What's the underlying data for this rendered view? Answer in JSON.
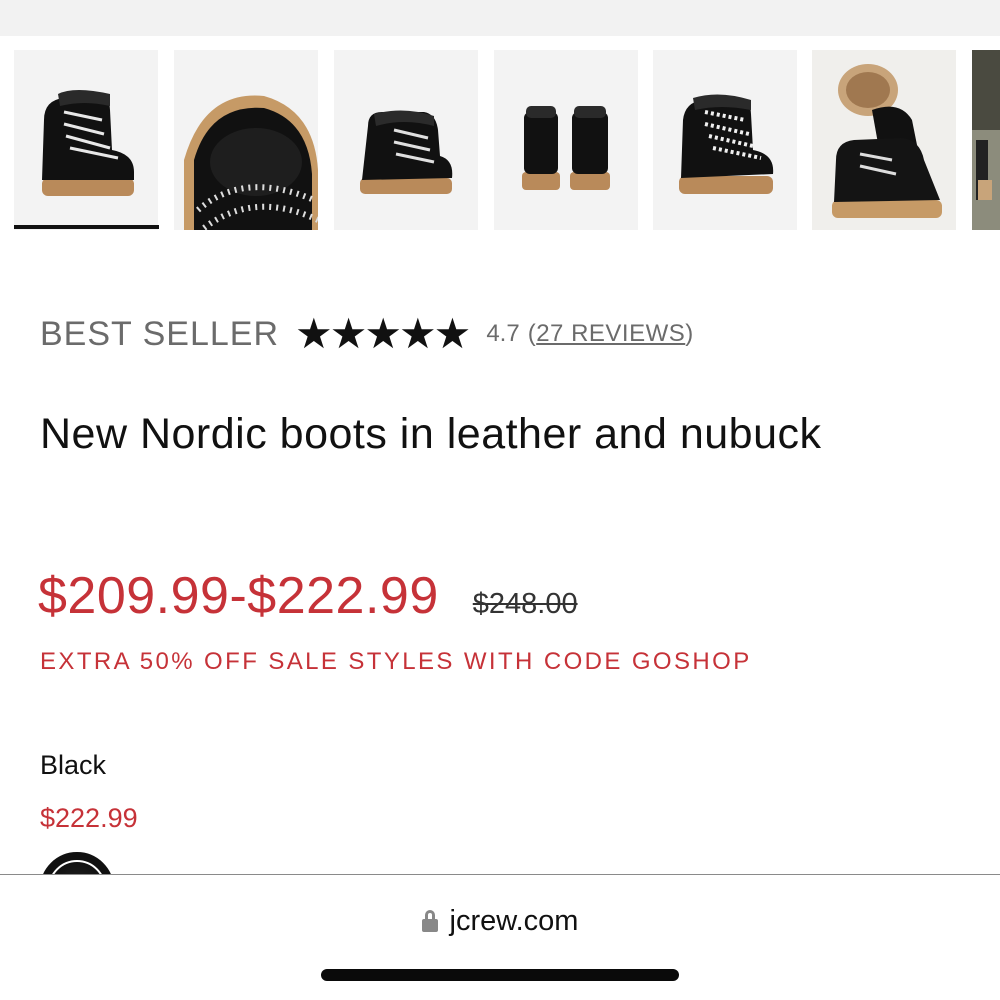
{
  "product": {
    "badge": "BEST SELLER",
    "rating": {
      "stars": [
        "★",
        "★",
        "★",
        "★",
        "★"
      ],
      "value": "4.7",
      "open_paren": "(",
      "reviews_label": "27 REVIEWS",
      "close_paren": ")"
    },
    "title": "New Nordic boots in leather and nubuck",
    "price_range": "$209.99-$222.99",
    "original_price": "$248.00",
    "promo": "EXTRA 50% OFF SALE STYLES WITH CODE GOSHOP",
    "selected_color": {
      "name": "Black",
      "price": "$222.99"
    }
  },
  "browser": {
    "domain": "jcrew.com",
    "lock_icon": "lock-icon"
  },
  "colors": {
    "sale_red": "#c63238",
    "muted_gray": "#6b6b6b",
    "thumb_bg": "#f3f3f3"
  }
}
